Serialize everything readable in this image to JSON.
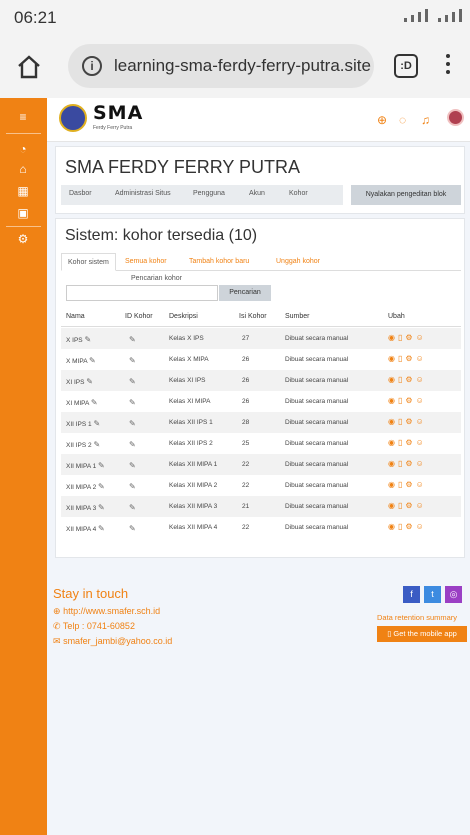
{
  "status_bar": {
    "time": "06:21"
  },
  "browser": {
    "url": "learning-sma-ferdy-ferry-putra.site",
    "tab_button": ":D"
  },
  "header": {
    "logo": "SMA",
    "logo_subtitle": "Ferdy Ferry Putra"
  },
  "school": {
    "title": "SMA FERDY FERRY PUTRA",
    "breadcrumbs": [
      "Dasbor",
      "Administrasi Situs",
      "Pengguna",
      "Akun",
      "Kohor"
    ],
    "edit_button": "Nyalakan pengeditan blok"
  },
  "cohorts": {
    "title": "Sistem: kohor tersedia (10)",
    "tabs": [
      "Kohor sistem",
      "Semua kohor",
      "Tambah kohor baru",
      "Unggah kohor"
    ],
    "search_label": "Pencarian kohor",
    "search_value": "",
    "search_button": "Pencarian",
    "headers": [
      "Nama",
      "ID Kohor",
      "Deskripsi",
      "Isi Kohor",
      "Sumber",
      "Ubah"
    ],
    "rows": [
      {
        "name": "X IPS",
        "desc": "Kelas X IPS",
        "count": "27",
        "source": "Dibuat secara manual"
      },
      {
        "name": "X MIPA",
        "desc": "Kelas X MIPA",
        "count": "26",
        "source": "Dibuat secara manual"
      },
      {
        "name": "XI IPS",
        "desc": "Kelas XI IPS",
        "count": "26",
        "source": "Dibuat secara manual"
      },
      {
        "name": "XI MIPA",
        "desc": "Kelas XI MIPA",
        "count": "26",
        "source": "Dibuat secara manual"
      },
      {
        "name": "XII IPS 1",
        "desc": "Kelas XII IPS 1",
        "count": "28",
        "source": "Dibuat secara manual"
      },
      {
        "name": "XII IPS 2",
        "desc": "Kelas XII IPS 2",
        "count": "25",
        "source": "Dibuat secara manual"
      },
      {
        "name": "XII MIPA 1",
        "desc": "Kelas XII MIPA 1",
        "count": "22",
        "source": "Dibuat secara manual"
      },
      {
        "name": "XII MIPA 2",
        "desc": "Kelas XII MIPA 2",
        "count": "22",
        "source": "Dibuat secara manual"
      },
      {
        "name": "XII MIPA 3",
        "desc": "Kelas XII MIPA 3",
        "count": "21",
        "source": "Dibuat secara manual"
      },
      {
        "name": "XII MIPA 4",
        "desc": "Kelas XII MIPA 4",
        "count": "22",
        "source": "Dibuat secara manual"
      }
    ]
  },
  "footer": {
    "title": "Stay in touch",
    "website": "http://www.smafer.sch.id",
    "phone": "Telp : 0741-60852",
    "email": "smafer_jambi@yahoo.co.id",
    "retention": "Data retention summary",
    "mobile_app": "Get the mobile app"
  },
  "colors": {
    "accent": "#f08214",
    "page_bg": "#f2f5fa"
  }
}
